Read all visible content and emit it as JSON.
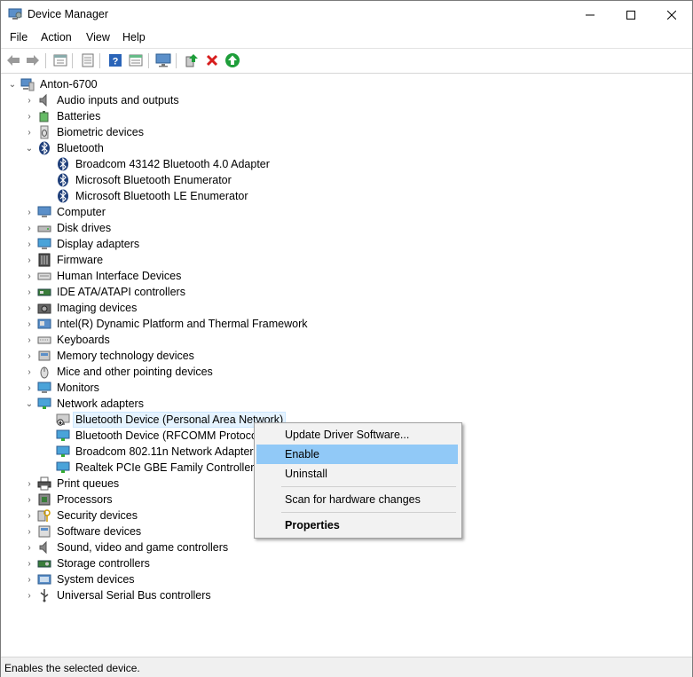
{
  "window": {
    "title": "Device Manager"
  },
  "menu": [
    "File",
    "Action",
    "View",
    "Help"
  ],
  "toolbar": [
    "back-icon",
    "forward-icon",
    "properties-sheet-icon",
    "driver-icon",
    "help-icon",
    "action-list-icon",
    "monitor-scan-icon",
    "update-driver-icon",
    "uninstall-x-icon",
    "enable-arrow-icon"
  ],
  "tree": {
    "root": "Anton-6700",
    "categories": [
      {
        "label": "Audio inputs and outputs",
        "icon": "speaker-icon",
        "expanded": false
      },
      {
        "label": "Batteries",
        "icon": "battery-icon",
        "expanded": false
      },
      {
        "label": "Biometric devices",
        "icon": "biometric-icon",
        "expanded": false
      },
      {
        "label": "Bluetooth",
        "icon": "bluetooth-icon",
        "expanded": true,
        "children": [
          {
            "label": "Broadcom 43142 Bluetooth 4.0 Adapter",
            "icon": "bluetooth-icon"
          },
          {
            "label": "Microsoft Bluetooth Enumerator",
            "icon": "bluetooth-icon"
          },
          {
            "label": "Microsoft Bluetooth LE Enumerator",
            "icon": "bluetooth-icon"
          }
        ]
      },
      {
        "label": "Computer",
        "icon": "computer-icon",
        "expanded": false
      },
      {
        "label": "Disk drives",
        "icon": "disk-icon",
        "expanded": false
      },
      {
        "label": "Display adapters",
        "icon": "display-icon",
        "expanded": false
      },
      {
        "label": "Firmware",
        "icon": "firmware-icon",
        "expanded": false
      },
      {
        "label": "Human Interface Devices",
        "icon": "hid-icon",
        "expanded": false
      },
      {
        "label": "IDE ATA/ATAPI controllers",
        "icon": "ide-icon",
        "expanded": false
      },
      {
        "label": "Imaging devices",
        "icon": "camera-icon",
        "expanded": false
      },
      {
        "label": "Intel(R) Dynamic Platform and Thermal Framework",
        "icon": "chip-icon",
        "expanded": false
      },
      {
        "label": "Keyboards",
        "icon": "keyboard-icon",
        "expanded": false
      },
      {
        "label": "Memory technology devices",
        "icon": "memory-icon",
        "expanded": false
      },
      {
        "label": "Mice and other pointing devices",
        "icon": "mouse-icon",
        "expanded": false
      },
      {
        "label": "Monitors",
        "icon": "monitor-icon",
        "expanded": false
      },
      {
        "label": "Network adapters",
        "icon": "network-icon",
        "expanded": true,
        "children": [
          {
            "label": "Bluetooth Device (Personal Area Network)",
            "icon": "network-disabled-icon",
            "selected": true
          },
          {
            "label": "Bluetooth Device (RFCOMM Protocol T",
            "icon": "network-icon"
          },
          {
            "label": "Broadcom 802.11n Network Adapter",
            "icon": "network-icon"
          },
          {
            "label": "Realtek PCIe GBE Family Controller",
            "icon": "network-icon"
          }
        ]
      },
      {
        "label": "Print queues",
        "icon": "printer-icon",
        "expanded": false
      },
      {
        "label": "Processors",
        "icon": "processor-icon",
        "expanded": false
      },
      {
        "label": "Security devices",
        "icon": "security-key-icon",
        "expanded": false
      },
      {
        "label": "Software devices",
        "icon": "software-icon",
        "expanded": false
      },
      {
        "label": "Sound, video and game controllers",
        "icon": "speaker-icon",
        "expanded": false
      },
      {
        "label": "Storage controllers",
        "icon": "storage-icon",
        "expanded": false
      },
      {
        "label": "System devices",
        "icon": "system-icon",
        "expanded": false
      },
      {
        "label": "Universal Serial Bus controllers",
        "icon": "usb-icon",
        "expanded": false
      }
    ]
  },
  "context_menu": {
    "items": [
      {
        "label": "Update Driver Software..."
      },
      {
        "label": "Enable",
        "highlighted": true
      },
      {
        "label": "Uninstall"
      },
      {
        "separator": true
      },
      {
        "label": "Scan for hardware changes"
      },
      {
        "separator": true
      },
      {
        "label": "Properties",
        "bold": true
      }
    ]
  },
  "status": "Enables the selected device.",
  "colors": {
    "selection": "#e5f3ff",
    "menu_highlight": "#91c9f7",
    "enable_green": "#1e9e3a",
    "uninstall_red": "#d71d1d"
  }
}
